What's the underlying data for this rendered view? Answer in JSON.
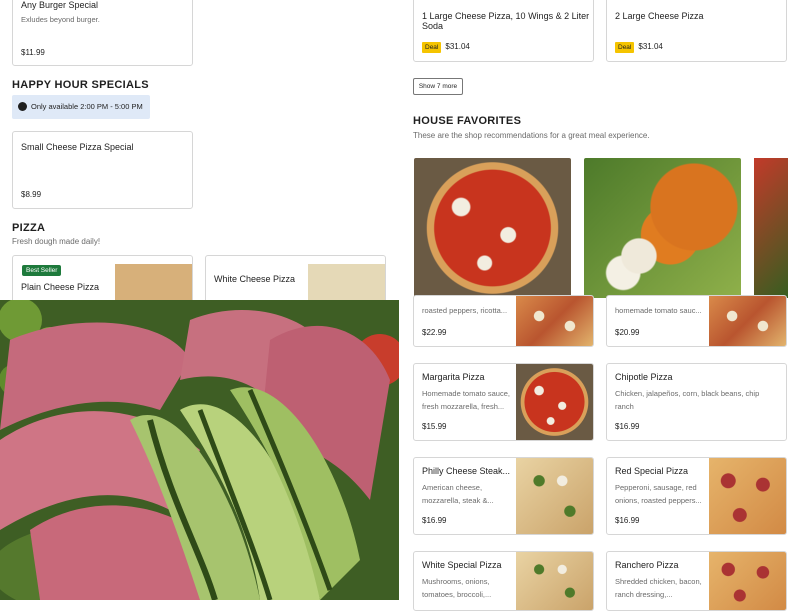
{
  "left_top_card": {
    "name": "Any Burger Special",
    "desc": "Exludes beyond burger.",
    "price": "$11.99"
  },
  "happy_hour": {
    "title": "HAPPY HOUR SPECIALS",
    "availability": "Only available 2:00 PM - 5:00 PM",
    "card": {
      "name": "Small Cheese Pizza Special",
      "price": "$8.99"
    }
  },
  "pizza_section": {
    "title": "PIZZA",
    "subtitle": "Fresh dough made daily!",
    "cards": [
      {
        "badge": "Best Seller",
        "name": "Plain Cheese Pizza"
      },
      {
        "name": "White Cheese Pizza"
      }
    ]
  },
  "deals": [
    {
      "name": "1 Large Cheese Pizza, 10 Wings & 2 Liter Soda",
      "badge": "Deal",
      "price": "$31.04"
    },
    {
      "name": "2 Large Cheese Pizza",
      "badge": "Deal",
      "price": "$31.04"
    }
  ],
  "show_more_label": "Show 7 more",
  "house_favorites": {
    "title": "HOUSE FAVORITES",
    "subtitle": "These are the shop recommendations for a great meal experience."
  },
  "menu_items": [
    {
      "desc": "roasted peppers, ricotta...",
      "price": "$22.99"
    },
    {
      "desc": "homemade tomato sauc...",
      "price": "$20.99"
    },
    {
      "name": "Margarita Pizza",
      "desc": "Homemade tomato sauce, fresh mozzarella, fresh...",
      "price": "$15.99"
    },
    {
      "name": "Chipotle Pizza",
      "desc": "Chicken, jalapeños, corn, black beans, chip ranch",
      "price": "$16.99"
    },
    {
      "name": "Philly Cheese Steak...",
      "desc": "American cheese, mozzarella, steak &...",
      "price": "$16.99"
    },
    {
      "name": "Red Special Pizza",
      "desc": "Pepperoni, sausage, red onions, roasted peppers...",
      "price": "$16.99"
    },
    {
      "name": "White Special Pizza",
      "desc": "Mushrooms, onions, tomatoes, broccoli,...",
      "price": ""
    },
    {
      "name": "Ranchero Pizza",
      "desc": "Shredded chicken, bacon, ranch dressing,...",
      "price": ""
    }
  ],
  "colors": {
    "deal_badge": "#f5c400",
    "best_seller_badge": "#1e7a3c",
    "info_banner": "#dfe9f7"
  }
}
